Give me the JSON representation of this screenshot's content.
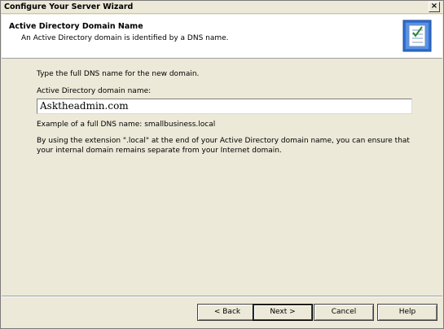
{
  "window": {
    "title": "Configure Your Server Wizard",
    "close_glyph": "×"
  },
  "header": {
    "title": "Active Directory Domain Name",
    "subtitle": "An Active Directory domain is identified by a DNS name."
  },
  "content": {
    "instruction": "Type the full DNS name for the new domain.",
    "field_label": "Active Directory domain name:",
    "field_value": "Asktheadmin.com",
    "example": "Example of a full DNS name: smallbusiness.local",
    "explanation": "By using the extension \".local\" at the end of your Active Directory domain name, you can ensure that your internal domain remains separate from your Internet domain."
  },
  "buttons": {
    "back": "< Back",
    "next": "Next >",
    "cancel": "Cancel",
    "help": "Help"
  }
}
